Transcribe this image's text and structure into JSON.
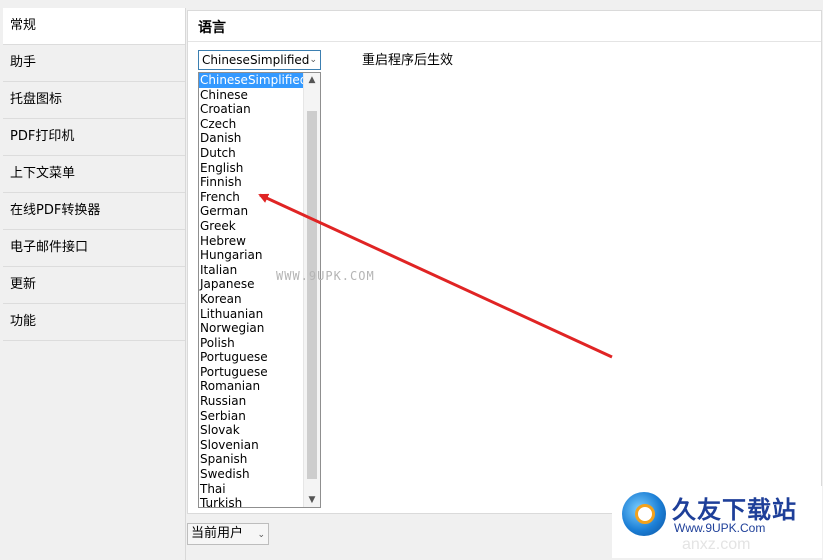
{
  "sidebar": {
    "items": [
      {
        "label": "常规",
        "active": true
      },
      {
        "label": "助手"
      },
      {
        "label": "托盘图标"
      },
      {
        "label": "PDF打印机"
      },
      {
        "label": "上下文菜单"
      },
      {
        "label": "在线PDF转换器"
      },
      {
        "label": "电子邮件接口"
      },
      {
        "label": "更新"
      },
      {
        "label": "功能"
      }
    ]
  },
  "main": {
    "section_title": "语言",
    "language_select": {
      "selected": "ChineseSimplified",
      "expanded": true,
      "options": [
        "ChineseSimplified",
        "Chinese",
        "Croatian",
        "Czech",
        "Danish",
        "Dutch",
        "English",
        "Finnish",
        "French",
        "German",
        "Greek",
        "Hebrew",
        "Hungarian",
        "Italian",
        "Japanese",
        "Korean",
        "Lithuanian",
        "Norwegian",
        "Polish",
        "Portuguese",
        "Portuguese",
        "Romanian",
        "Russian",
        "Serbian",
        "Slovak",
        "Slovenian",
        "Spanish",
        "Swedish",
        "Thai",
        "Turkish"
      ]
    },
    "restart_note": "重启程序后生效",
    "watermark": "WWW.9UPK.COM"
  },
  "footer": {
    "user_select_value": "当前用户"
  },
  "logo": {
    "name": "久友下载站",
    "url": "Www.9UPK.Com",
    "ghost_text": "anxz.com"
  },
  "colors": {
    "selection": "#3399ff",
    "arrow": "#e02424",
    "logo_text": "#1e3f99"
  },
  "icons": {
    "dropdown": "chevron-down-icon",
    "scroll_up": "chevron-up-icon",
    "scroll_down": "chevron-down-icon"
  }
}
